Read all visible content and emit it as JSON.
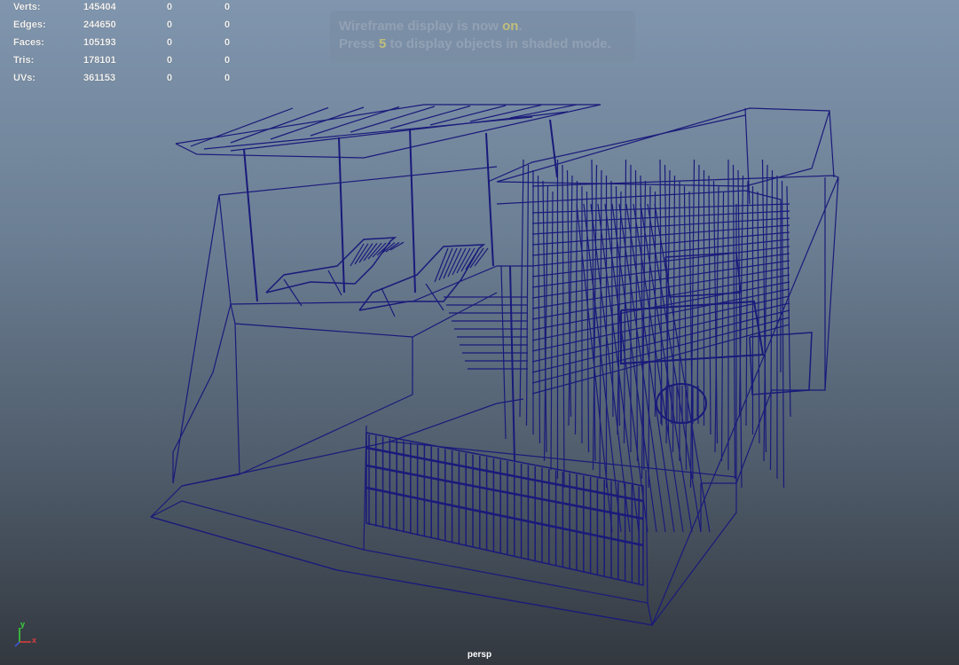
{
  "hud": {
    "rows": [
      {
        "label": "Verts:",
        "v1": "145404",
        "v2": "0",
        "v3": "0"
      },
      {
        "label": "Edges:",
        "v1": "244650",
        "v2": "0",
        "v3": "0"
      },
      {
        "label": "Faces:",
        "v1": "105193",
        "v2": "0",
        "v3": "0"
      },
      {
        "label": "Tris:",
        "v1": "178101",
        "v2": "0",
        "v3": "0"
      },
      {
        "label": "UVs:",
        "v1": "361153",
        "v2": "0",
        "v3": "0"
      }
    ]
  },
  "notice": {
    "line1_a": "Wireframe display is now ",
    "line1_b": "on",
    "line1_c": ".",
    "line2_a": "Press ",
    "line2_b": "5",
    "line2_c": " to display objects in shaded mode."
  },
  "camera": {
    "name": "persp"
  },
  "axis": {
    "y_label": "y",
    "x_label": "x"
  },
  "colors": {
    "wireframe": "#1a1a7a",
    "axis_y": "#3ad63a",
    "axis_x": "#e03c3c",
    "axis_z": "#3a5ae0"
  },
  "icons": {
    "axis": "view-axis-gizmo-icon"
  }
}
